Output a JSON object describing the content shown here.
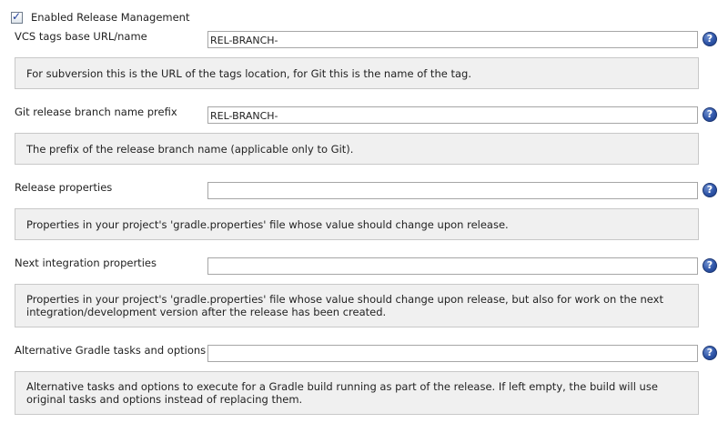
{
  "enable": {
    "label": "Enabled Release Management",
    "checked": true,
    "check_glyph": "✓"
  },
  "help_icon_glyph": "?",
  "fields": [
    {
      "label": "VCS tags base URL/name",
      "value": "REL-BRANCH-",
      "help": "For subversion this is the URL of the tags location, for Git this is the name of the tag."
    },
    {
      "label": "Git release branch name prefix",
      "value": "REL-BRANCH-",
      "help": "The prefix of the release branch name (applicable only to Git)."
    },
    {
      "label": "Release properties",
      "value": "",
      "help": "Properties in your project's 'gradle.properties' file whose value should change upon release."
    },
    {
      "label": "Next integration properties",
      "value": "",
      "help": "Properties in your project's 'gradle.properties' file whose value should change upon release, but also for work on the next integration/development version after the release has been created."
    },
    {
      "label": "Alternative Gradle tasks and options",
      "value": "",
      "help": "Alternative tasks and options to execute for a Gradle build running as part of the release. If left empty, the build will use original tasks and options instead of replacing them."
    }
  ]
}
